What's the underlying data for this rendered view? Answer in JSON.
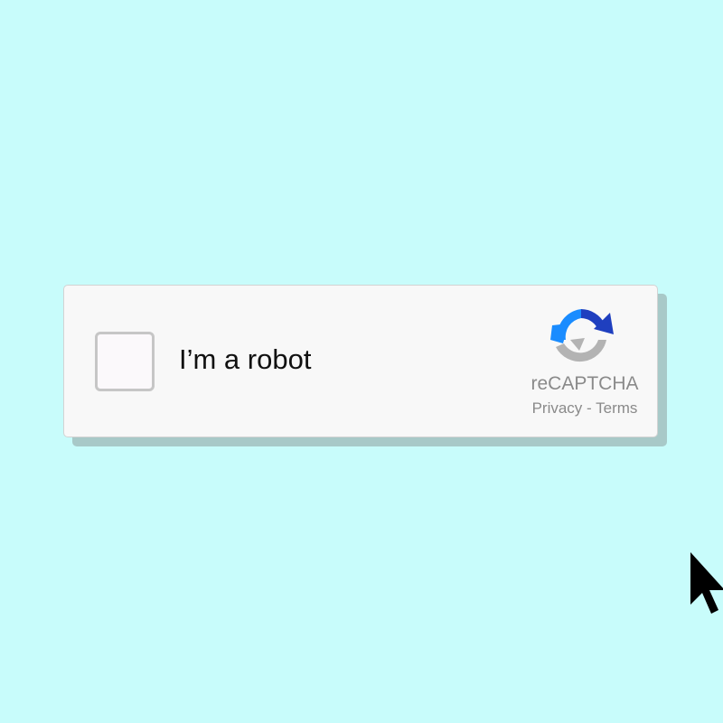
{
  "colors": {
    "background": "#c8fcfb",
    "card": "#f8f8f8",
    "card_shadow": "#a8c9c8",
    "text_gray": "#8a8a8a",
    "logo_blue_light": "#1a8cff",
    "logo_blue_dark": "#1f3fbf",
    "logo_gray": "#b3b3b3",
    "cursor": "#000000"
  },
  "captcha": {
    "checkbox_checked": false,
    "label": "I’m a robot",
    "brand": "reCAPTCHA",
    "privacy_link": "Privacy",
    "separator": " - ",
    "terms_link": "Terms",
    "logo_icon": "recaptcha-logo-icon"
  },
  "cursor": {
    "icon": "mouse-pointer-icon"
  }
}
